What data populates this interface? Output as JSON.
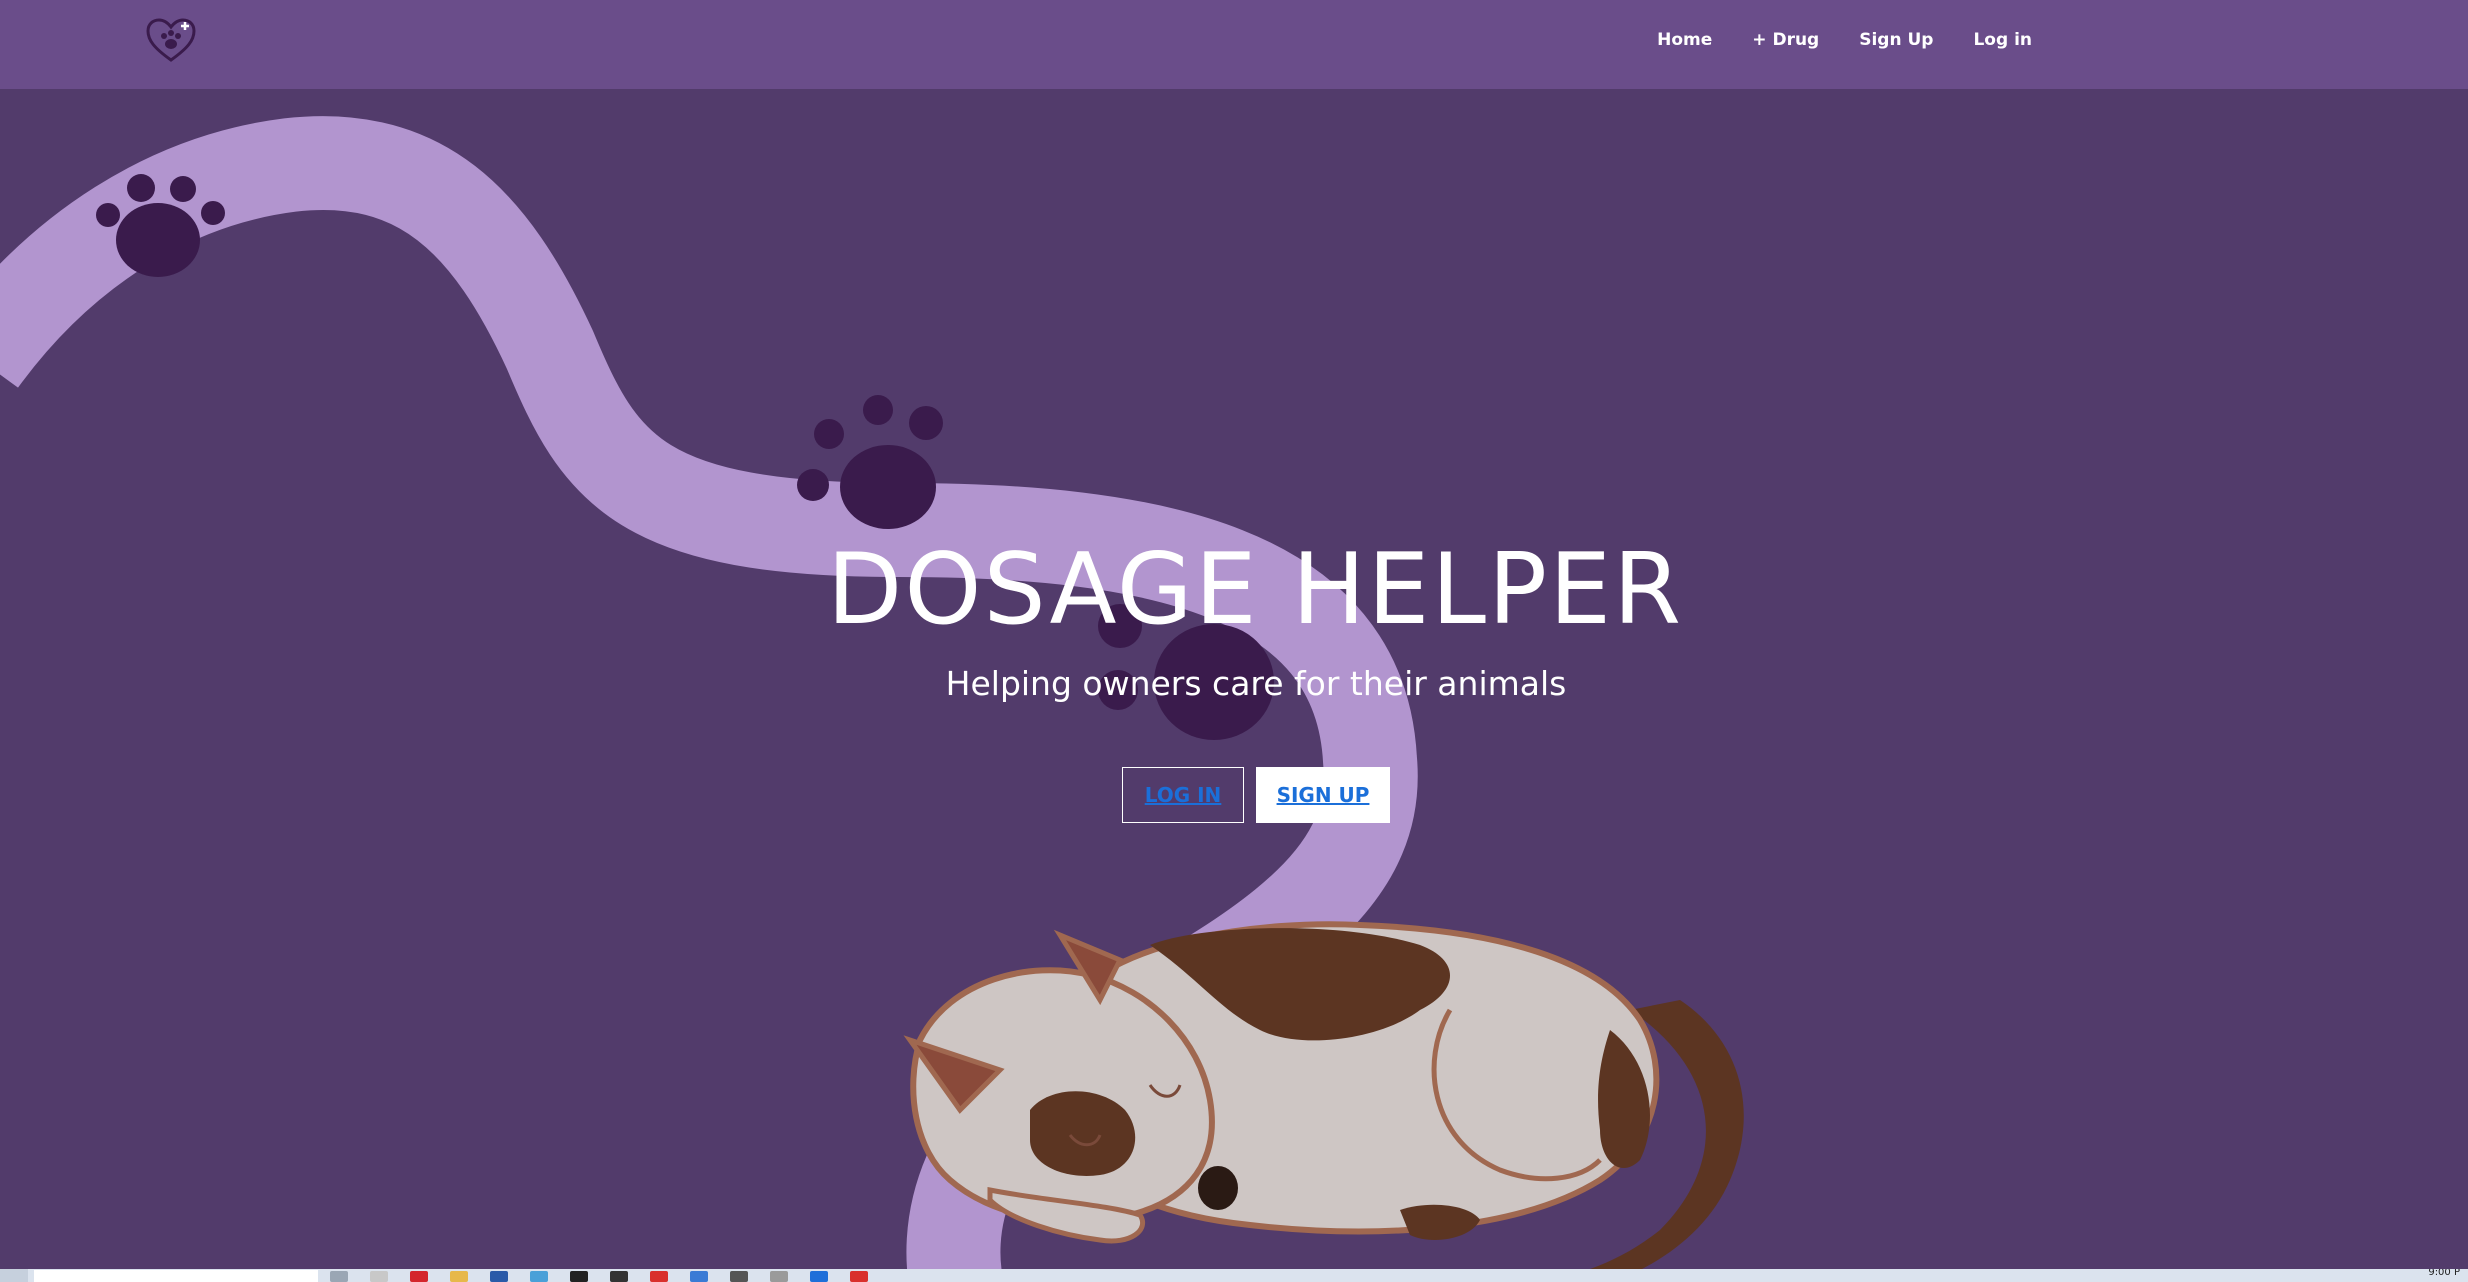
{
  "nav": {
    "logo_icon": "heart-paw-plus-icon",
    "links": [
      "Home",
      "+ Drug",
      "Sign Up",
      "Log in"
    ]
  },
  "hero": {
    "title": "DOSAGE HELPER",
    "subtitle": "Helping owners care for their animals",
    "login_label": "LOG IN",
    "signup_label": "SIGN UP"
  },
  "taskbar": {
    "clock": "9:00 P"
  },
  "colors": {
    "navbar": "#6a4d8a",
    "background": "#523b6b",
    "ribbon": "#b295cf",
    "paw": "#3a1b4c",
    "link": "#1b6fd9"
  }
}
